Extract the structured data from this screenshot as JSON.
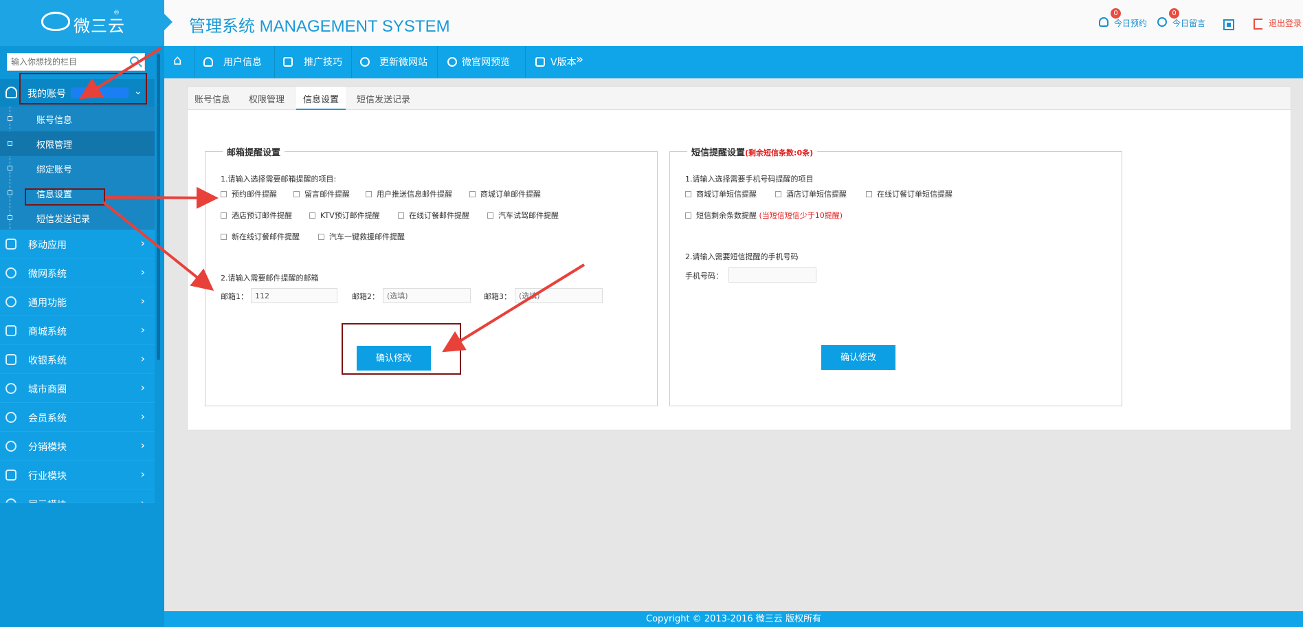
{
  "brand": {
    "logo_text": "微三云",
    "registered": "®"
  },
  "header": {
    "title": "管理系统 MANAGEMENT SYSTEM",
    "links": [
      {
        "label": "今日预约",
        "badge": "0"
      },
      {
        "label": "今日留言",
        "badge": "0"
      },
      {
        "label": "退出登录"
      }
    ]
  },
  "sidebar": {
    "search_placeholder": "输入你想找的栏目",
    "account": {
      "label": "我的账号"
    },
    "submenu": [
      {
        "label": "账号信息"
      },
      {
        "label": "权限管理"
      },
      {
        "label": "绑定账号"
      },
      {
        "label": "信息设置"
      },
      {
        "label": "短信发送记录"
      }
    ],
    "menu": [
      {
        "label": "移动应用"
      },
      {
        "label": "微网系统"
      },
      {
        "label": "通用功能"
      },
      {
        "label": "商城系统"
      },
      {
        "label": "收银系统"
      },
      {
        "label": "城市商圈"
      },
      {
        "label": "会员系统"
      },
      {
        "label": "分销模块"
      },
      {
        "label": "行业模块"
      },
      {
        "label": "展示模块"
      }
    ]
  },
  "navbar": {
    "items": [
      {
        "label": "用户信息"
      },
      {
        "label": "推广技巧"
      },
      {
        "label": "更新微网站"
      },
      {
        "label": "微官网预览"
      },
      {
        "label": "V版本"
      }
    ],
    "more": "»"
  },
  "tabs": [
    {
      "label": "账号信息"
    },
    {
      "label": "权限管理"
    },
    {
      "label": "信息设置",
      "active": true
    },
    {
      "label": "短信发送记录"
    }
  ],
  "email_settings": {
    "legend": "邮箱提醒设置",
    "q1": "1.请输入选择需要邮箱提醒的项目:",
    "options_row1": [
      "预约邮件提醒",
      "留言邮件提醒",
      "用户推送信息邮件提醒",
      "商城订单邮件提醒"
    ],
    "options_row2": [
      "酒店预订邮件提醒",
      "KTV预订邮件提醒",
      "在线订餐邮件提醒",
      "汽车试驾邮件提醒"
    ],
    "options_row3": [
      "新在线订餐邮件提醒",
      "汽车一键救援邮件提醒"
    ],
    "q2": "2.请输入需要邮件提醒的邮箱",
    "email1_label": "邮箱1：",
    "email1_value": "112",
    "email2_label": "邮箱2：",
    "email2_placeholder": "(选填)",
    "email3_label": "邮箱3：",
    "email3_placeholder": "(选填)",
    "submit": "确认修改"
  },
  "sms_settings": {
    "legend": "短信提醒设置",
    "legend_note": "(剩余短信条数:0条)",
    "q1": "1.请输入选择需要手机号码提醒的项目",
    "options_row1": [
      "商城订单短信提醒",
      "酒店订单短信提醒",
      "在线订餐订单短信提醒"
    ],
    "balance_option": "短信剩余条数提醒",
    "balance_note": "(当短信短信少于10提醒)",
    "q2": "2.请输入需要短信提醒的手机号码",
    "phone_label": "手机号码：",
    "submit": "确认修改"
  },
  "footer": {
    "text": "Copyright © 2013-2016    微三云 版权所有"
  },
  "colors": {
    "primary": "#10a5e8",
    "sidebar": "#0d96d8",
    "highlight_box": "#7b1212",
    "arrow": "#e8413a"
  }
}
